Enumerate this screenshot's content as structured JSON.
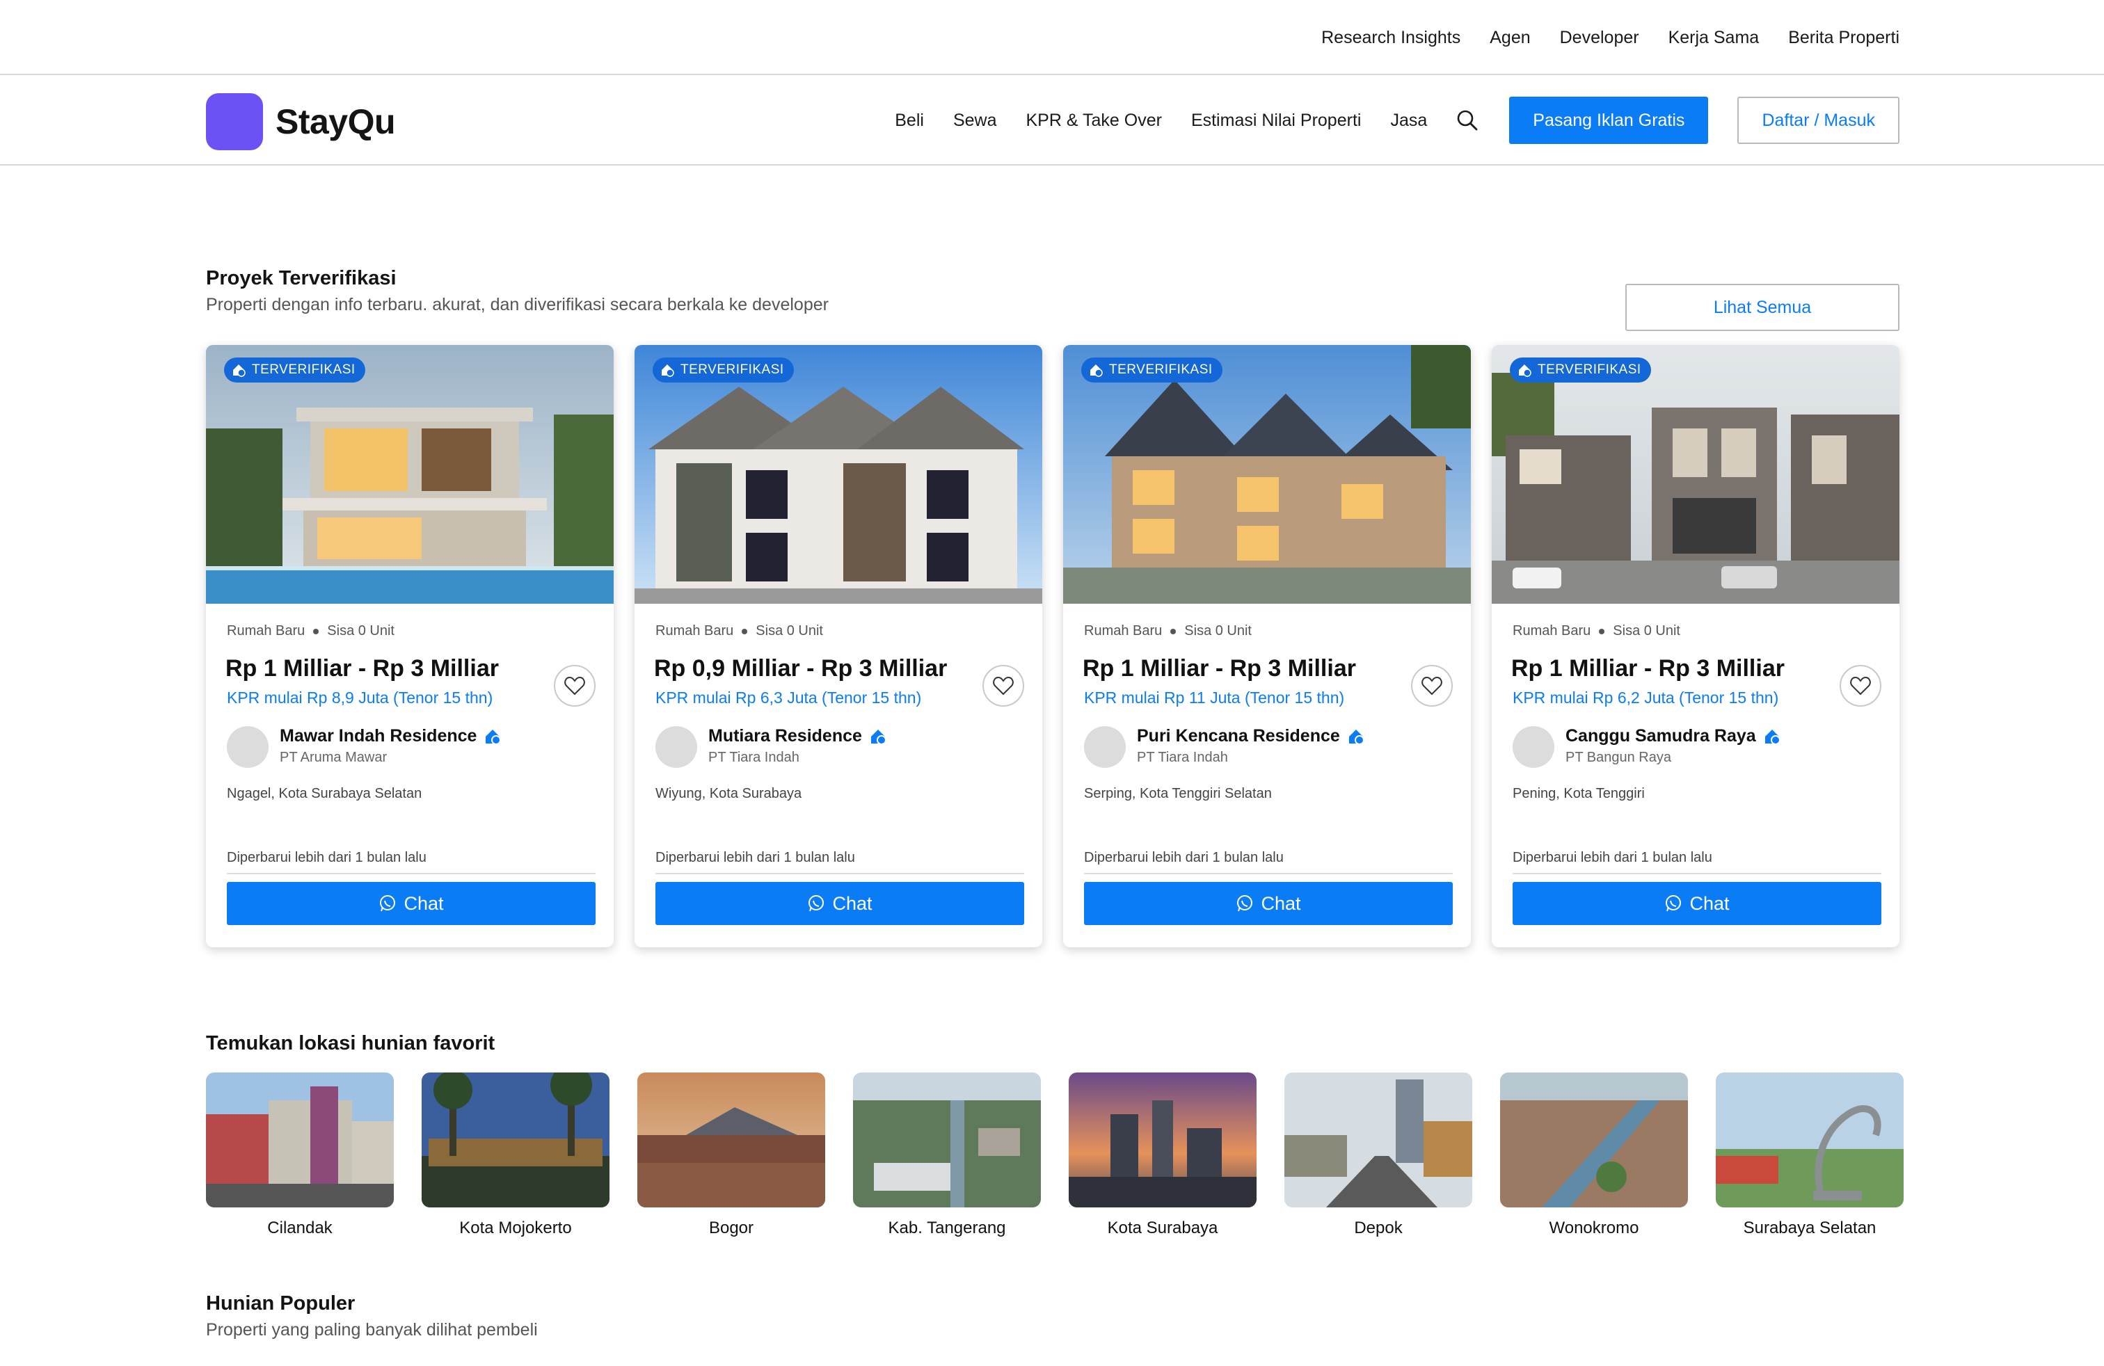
{
  "topbar": {
    "links": [
      "Research Insights",
      "Agen",
      "Developer",
      "Kerja Sama",
      "Berita Properti"
    ]
  },
  "navbar": {
    "brand": "StayQu",
    "items": [
      "Beli",
      "Sewa",
      "KPR & Take Over",
      "Estimasi Nilai Properti",
      "Jasa"
    ],
    "cta_primary": "Pasang Iklan Gratis",
    "cta_secondary": "Daftar / Masuk"
  },
  "verified": {
    "title": "Proyek Terverifikasi",
    "subtitle": "Properti dengan info terbaru. akurat, dan diverifikasi secara berkala ke developer",
    "see_all": "Lihat Semua",
    "cards": [
      {
        "badge": "TERVERIFIKASI",
        "type": "Rumah Baru",
        "stock": "Sisa 0 Unit",
        "price": "Rp 1 Milliar - Rp 3 Milliar",
        "kpr": "KPR mulai Rp 8,9 Juta (Tenor 15 thn)",
        "project": "Mawar Indah Residence",
        "developer": "PT Aruma Mawar",
        "location": "Ngagel, Kota Surabaya Selatan",
        "updated": "Diperbarui lebih dari 1 bulan lalu",
        "chat": "Chat"
      },
      {
        "badge": "TERVERIFIKASI",
        "type": "Rumah Baru",
        "stock": "Sisa 0 Unit",
        "price": "Rp 0,9 Milliar - Rp 3 Milliar",
        "kpr": "KPR mulai Rp 6,3 Juta (Tenor 15 thn)",
        "project": "Mutiara Residence",
        "developer": "PT Tiara Indah",
        "location": "Wiyung, Kota Surabaya",
        "updated": "Diperbarui lebih dari 1 bulan lalu",
        "chat": "Chat"
      },
      {
        "badge": "TERVERIFIKASI",
        "type": "Rumah Baru",
        "stock": "Sisa 0 Unit",
        "price": "Rp 1 Milliar - Rp 3 Milliar",
        "kpr": "KPR mulai Rp 11 Juta (Tenor 15 thn)",
        "project": "Puri Kencana Residence",
        "developer": "PT Tiara Indah",
        "location": "Serping, Kota Tenggiri Selatan",
        "updated": "Diperbarui lebih dari 1 bulan lalu",
        "chat": "Chat"
      },
      {
        "badge": "TERVERIFIKASI",
        "type": "Rumah Baru",
        "stock": "Sisa 0 Unit",
        "price": "Rp 1 Milliar - Rp 3 Milliar",
        "kpr": "KPR mulai Rp 6,2 Juta (Tenor 15 thn)",
        "project": "Canggu Samudra Raya",
        "developer": "PT Bangun Raya",
        "location": "Pening, Kota Tenggiri",
        "updated": "Diperbarui lebih dari 1 bulan lalu",
        "chat": "Chat"
      }
    ]
  },
  "locations": {
    "title": "Temukan lokasi hunian favorit",
    "items": [
      "Cilandak",
      "Kota Mojokerto",
      "Bogor",
      "Kab. Tangerang",
      "Kota Surabaya",
      "Depok",
      "Wonokromo",
      "Surabaya Selatan"
    ]
  },
  "popular": {
    "title": "Hunian Populer",
    "subtitle": "Properti yang paling banyak dilihat pembeli"
  },
  "colors": {
    "accent": "#0a7cf5",
    "brand": "#6a52f5",
    "badge": "#1467d6"
  }
}
